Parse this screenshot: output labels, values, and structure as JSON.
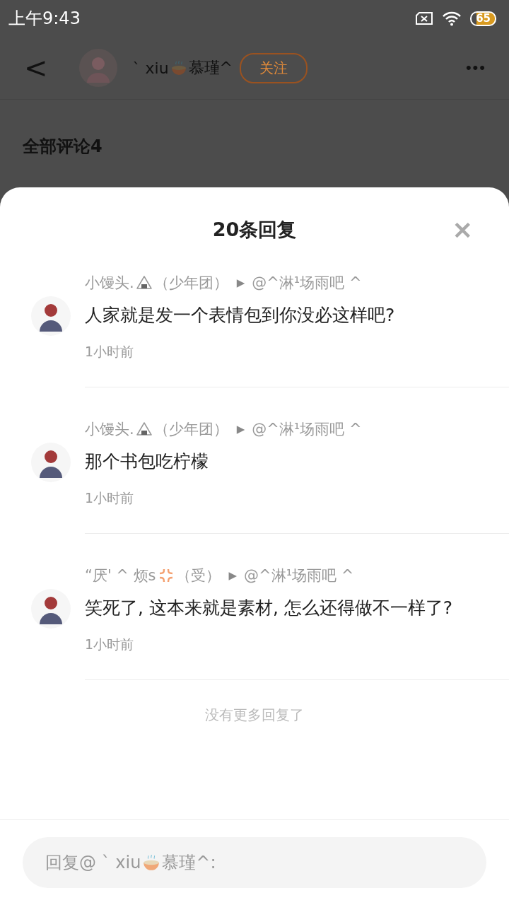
{
  "status_bar": {
    "time": "上午9:43",
    "battery": "65"
  },
  "header": {
    "back": "<",
    "name_before": "` xiu",
    "name_emoji": {
      "kind": "noodles"
    },
    "name_after": "慕瑾^",
    "follow": "关注",
    "more": "•••"
  },
  "section_title": "全部评论4",
  "sheet": {
    "title": "20条回复",
    "close": "✕",
    "comments": [
      {
        "author": "小馒头.",
        "emoji": {
          "kind": "rice_ball"
        },
        "tag": "（少年团）",
        "arrow": "▶",
        "reply_to": "@^淋¹场雨吧 ^",
        "text": "人家就是发一个表情包到你没必这样吧?",
        "time": "1小时前"
      },
      {
        "author": "小馒头.",
        "emoji": {
          "kind": "rice_ball"
        },
        "tag": "（少年团）",
        "arrow": "▶",
        "reply_to": "@^淋¹场雨吧 ^",
        "text": "那个书包吃柠檬",
        "time": "1小时前"
      },
      {
        "author": "“厌' ^ 烦s",
        "emoji": {
          "kind": "anger"
        },
        "tag": "（受）",
        "arrow": "▶",
        "reply_to": "@^淋¹场雨吧 ^",
        "text": "笑死了, 这本来就是素材, 怎么还得做不一样了?",
        "time": "1小时前"
      }
    ],
    "end_note": "没有更多回复了"
  },
  "reply_field": {
    "placeholder_before": "回复@ ` xiu",
    "placeholder_emoji": {
      "kind": "noodles"
    },
    "placeholder_after": "慕瑾^:"
  }
}
